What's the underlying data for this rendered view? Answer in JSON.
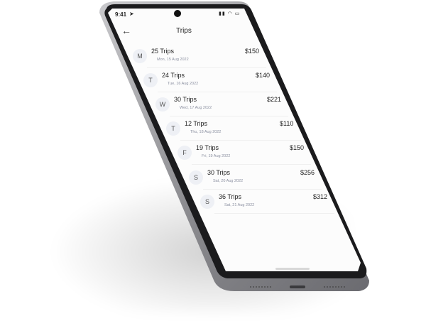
{
  "status": {
    "time": "9:41",
    "icons": "▮▮ ◠ ▭"
  },
  "header": {
    "title": "Trips"
  },
  "trips": [
    {
      "day": "M",
      "trips": "25 Trips",
      "date": "Mon, 15 Aug 2022",
      "amount": "$150"
    },
    {
      "day": "T",
      "trips": "24 Trips",
      "date": "Tue, 16 Aug 2022",
      "amount": "$140"
    },
    {
      "day": "W",
      "trips": "30 Trips",
      "date": "Wed, 17 Aug 2022",
      "amount": "$221"
    },
    {
      "day": "T",
      "trips": "12 Trips",
      "date": "Thu, 18 Aug 2022",
      "amount": "$110"
    },
    {
      "day": "F",
      "trips": "19 Trips",
      "date": "Fri, 19 Aug 2022",
      "amount": "$150"
    },
    {
      "day": "S",
      "trips": "30 Trips",
      "date": "Sat, 20 Aug 2022",
      "amount": "$256"
    },
    {
      "day": "S",
      "trips": "36 Trips",
      "date": "Sat, 21 Aug 2022",
      "amount": "$312"
    }
  ]
}
